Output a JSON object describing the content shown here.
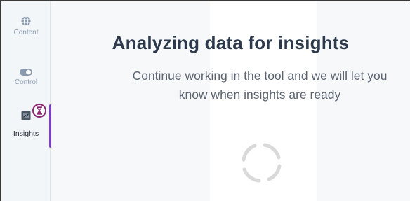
{
  "sidebar": {
    "items": [
      {
        "label": "Content",
        "icon": "globe-icon",
        "active": false
      },
      {
        "label": "Control",
        "icon": "toggle-icon",
        "active": false
      },
      {
        "label": "Insights",
        "icon": "insights-icon",
        "active": true
      }
    ],
    "badge_icon": "hourglass-icon"
  },
  "main": {
    "title": "Analyzing data for insights",
    "subtitle": "Continue working in the tool and we will let you know when insights are ready",
    "spinner_icon": "loading-spinner-icon"
  },
  "colors": {
    "accent": "#7b3fc6",
    "badge": "#8a2c74",
    "title": "#2d3a4b",
    "subtitle": "#5b6470",
    "nav_inactive": "#8a9bb0",
    "sidebar_bg": "#f3f6f9"
  }
}
